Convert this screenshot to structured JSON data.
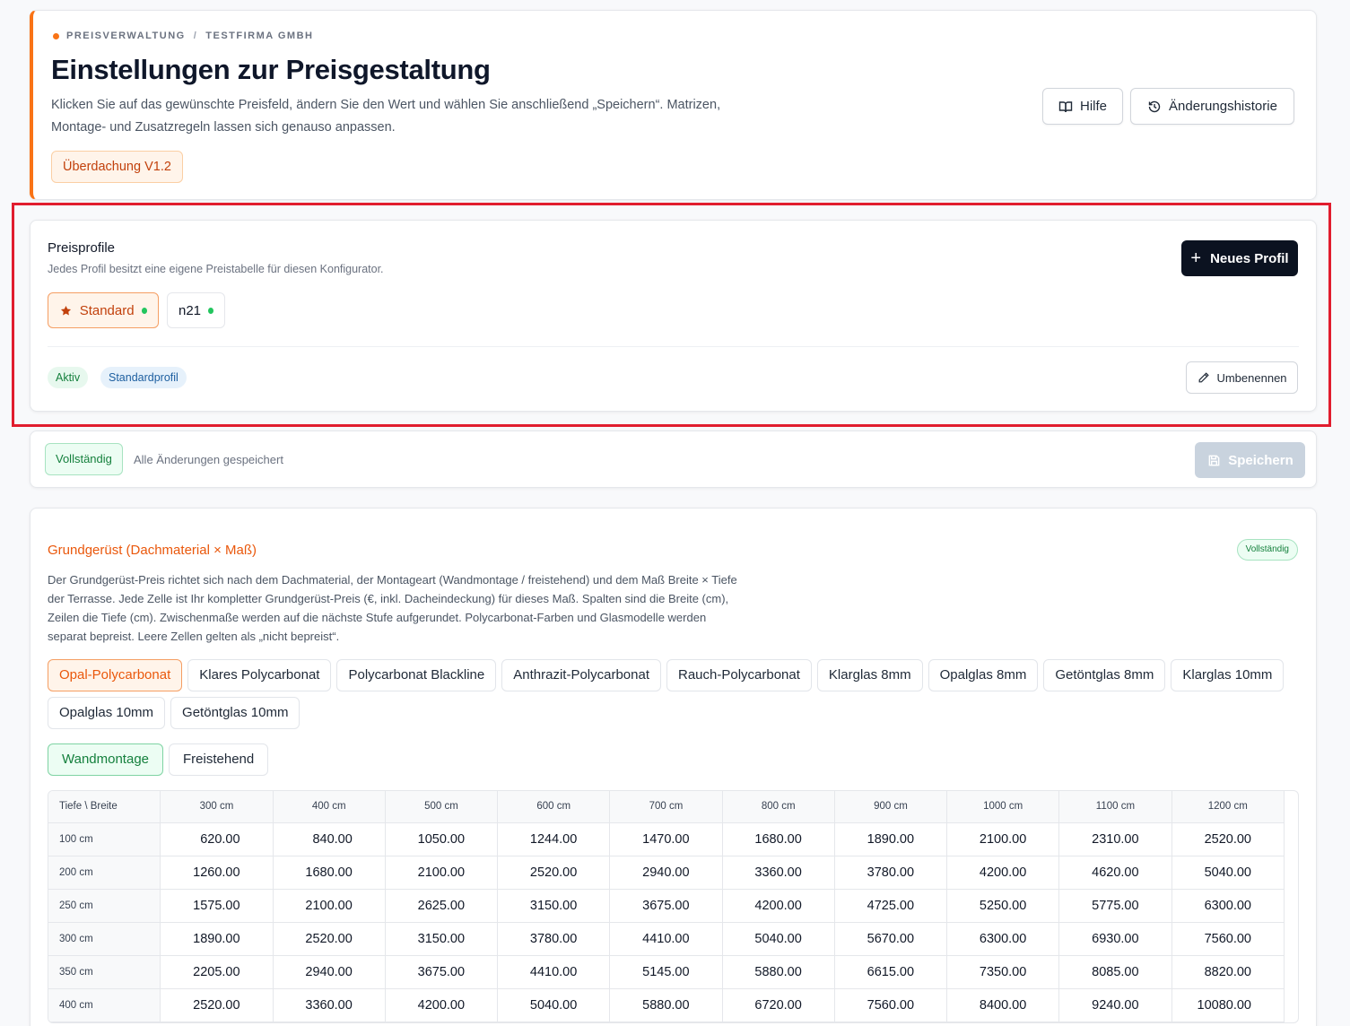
{
  "header": {
    "breadcrumb": [
      "PREISVERWALTUNG",
      "TESTFIRMA GMBH"
    ],
    "title": "Einstellungen zur Preisgestaltung",
    "description": "Klicken Sie auf das gewünschte Preisfeld, ändern Sie den Wert und wählen Sie anschließend „Speichern“. Matrizen, Montage- und Zusatzregeln lassen sich genauso anpassen.",
    "version_badge": "Überdachung V1.2",
    "help_label": "Hilfe",
    "history_label": "Änderungshistorie",
    "accent_color": "#f97316"
  },
  "profiles": {
    "title": "Preisprofile",
    "subtitle": "Jedes Profil besitzt eine eigene Preistabelle für diesen Konfigurator.",
    "new_profile_label": "Neues Profil",
    "tabs": [
      {
        "label": "Standard",
        "active": true,
        "default": true,
        "status": "green"
      },
      {
        "label": "n21",
        "active": false,
        "default": false,
        "status": "green"
      }
    ],
    "tags": [
      "Aktiv",
      "Standardprofil"
    ],
    "rename_label": "Umbenennen"
  },
  "status": {
    "badge": "Vollständig",
    "text": "Alle Änderungen gespeichert",
    "save_label": "Speichern"
  },
  "matrix": {
    "title": "Grundgerüst (Dachmaterial × Maß)",
    "badge": "Vollständig",
    "description": "Der Grundgerüst-Preis richtet sich nach dem Dachmaterial, der Montageart (Wandmontage / freistehend) und dem Maß Breite × Tiefe der Terrasse. Jede Zelle ist Ihr kompletter Grundgerüst-Preis (€, inkl. Dacheindeckung) für dieses Maß. Spalten sind die Breite (cm), Zeilen die Tiefe (cm). Zwischenmaße werden auf die nächste Stufe aufgerundet. Polycarbonat-Farben und Glasmodelle werden separat bepreist. Leere Zellen gelten als „nicht bepreist“.",
    "materials": [
      "Opal-Polycarbonat",
      "Klares Polycarbonat",
      "Polycarbonat Blackline",
      "Anthrazit-Polycarbonat",
      "Rauch-Polycarbonat",
      "Klarglas 8mm",
      "Opalglas 8mm",
      "Getöntglas 8mm",
      "Klarglas 10mm",
      "Opalglas 10mm",
      "Getöntglas 10mm"
    ],
    "active_material": "Opal-Polycarbonat",
    "mountings": [
      "Wandmontage",
      "Freistehend"
    ],
    "active_mounting": "Wandmontage",
    "corner_label": "Tiefe \\ Breite",
    "columns": [
      "300 cm",
      "400 cm",
      "500 cm",
      "600 cm",
      "700 cm",
      "800 cm",
      "900 cm",
      "1000 cm",
      "1100 cm",
      "1200 cm"
    ],
    "rows": [
      {
        "label": "100 cm",
        "values": [
          "620.00",
          "840.00",
          "1050.00",
          "1244.00",
          "1470.00",
          "1680.00",
          "1890.00",
          "2100.00",
          "2310.00",
          "2520.00"
        ]
      },
      {
        "label": "200 cm",
        "values": [
          "1260.00",
          "1680.00",
          "2100.00",
          "2520.00",
          "2940.00",
          "3360.00",
          "3780.00",
          "4200.00",
          "4620.00",
          "5040.00"
        ]
      },
      {
        "label": "250 cm",
        "values": [
          "1575.00",
          "2100.00",
          "2625.00",
          "3150.00",
          "3675.00",
          "4200.00",
          "4725.00",
          "5250.00",
          "5775.00",
          "6300.00"
        ]
      },
      {
        "label": "300 cm",
        "values": [
          "1890.00",
          "2520.00",
          "3150.00",
          "3780.00",
          "4410.00",
          "5040.00",
          "5670.00",
          "6300.00",
          "6930.00",
          "7560.00"
        ]
      },
      {
        "label": "350 cm",
        "values": [
          "2205.00",
          "2940.00",
          "3675.00",
          "4410.00",
          "5145.00",
          "5880.00",
          "6615.00",
          "7350.00",
          "8085.00",
          "8820.00"
        ]
      },
      {
        "label": "400 cm",
        "values": [
          "2520.00",
          "3360.00",
          "4200.00",
          "5040.00",
          "5880.00",
          "6720.00",
          "7560.00",
          "8400.00",
          "9240.00",
          "10080.00"
        ]
      }
    ]
  }
}
